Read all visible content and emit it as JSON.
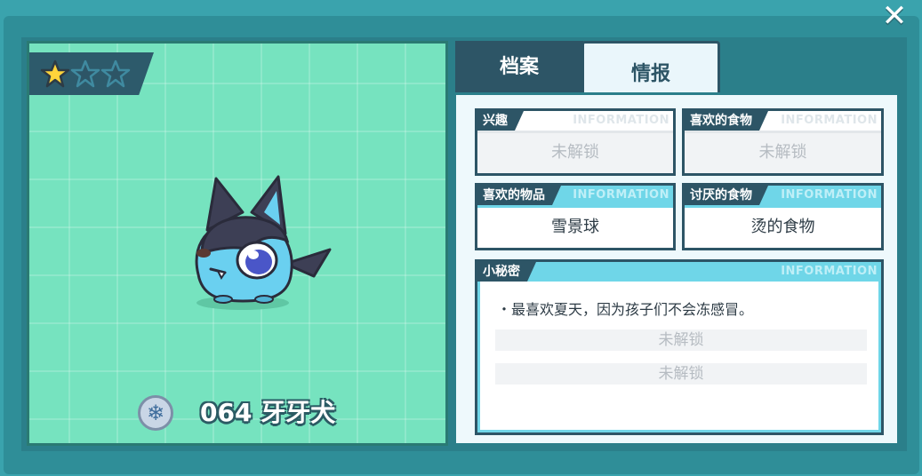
{
  "close_label": "✕",
  "pet": {
    "rarity_stars": 1,
    "rarity_max": 3,
    "element": "ice",
    "element_icon": "❄",
    "name": "064 牙牙犬"
  },
  "tabs": [
    {
      "label": "档案",
      "active": false
    },
    {
      "label": "情报",
      "active": true
    }
  ],
  "watermark": "INFORMATION",
  "cards": {
    "interest": {
      "title": "兴趣",
      "value": "未解锁",
      "locked": true
    },
    "favorite_food": {
      "title": "喜欢的食物",
      "value": "未解锁",
      "locked": true
    },
    "favorite_item": {
      "title": "喜欢的物品",
      "value": "雪景球",
      "locked": false
    },
    "disliked_food": {
      "title": "讨厌的食物",
      "value": "烫的食物",
      "locked": false
    }
  },
  "secret": {
    "title": "小秘密",
    "line": "・最喜欢夏天，因为孩子们不会冻感冒。",
    "locked_1": "未解锁",
    "locked_2": "未解锁"
  },
  "colors": {
    "background": "#3aa3ad",
    "panel_dark": "#2d5566",
    "pet_bg": "#76e3bf",
    "accent_cyan": "#6fd6e8",
    "star_gold": "#ffd43b"
  }
}
